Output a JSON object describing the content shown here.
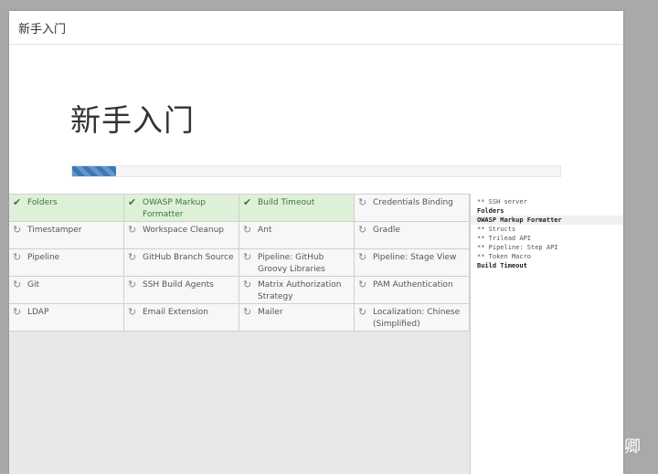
{
  "header": {
    "title": "新手入门"
  },
  "hero": {
    "title": "新手入门",
    "progress": 0.09
  },
  "plugins": [
    {
      "name": "Folders",
      "status": "success"
    },
    {
      "name": "OWASP Markup Formatter",
      "status": "success"
    },
    {
      "name": "Build Timeout",
      "status": "success"
    },
    {
      "name": "Credentials Binding",
      "status": "pending"
    },
    {
      "name": "Timestamper",
      "status": "pending"
    },
    {
      "name": "Workspace Cleanup",
      "status": "pending"
    },
    {
      "name": "Ant",
      "status": "pending"
    },
    {
      "name": "Gradle",
      "status": "pending"
    },
    {
      "name": "Pipeline",
      "status": "pending"
    },
    {
      "name": "GitHub Branch Source",
      "status": "pending"
    },
    {
      "name": "Pipeline: GitHub Groovy Libraries",
      "status": "pending"
    },
    {
      "name": "Pipeline: Stage View",
      "status": "pending"
    },
    {
      "name": "Git",
      "status": "pending"
    },
    {
      "name": "SSH Build Agents",
      "status": "pending"
    },
    {
      "name": "Matrix Authorization Strategy",
      "status": "pending"
    },
    {
      "name": "PAM Authentication",
      "status": "pending"
    },
    {
      "name": "LDAP",
      "status": "pending"
    },
    {
      "name": "Email Extension",
      "status": "pending"
    },
    {
      "name": "Mailer",
      "status": "pending"
    },
    {
      "name": "Localization: Chinese (Simplified)",
      "status": "pending"
    }
  ],
  "status_icons": {
    "success": "checkmark-icon",
    "pending": "refresh-icon"
  },
  "colors": {
    "success_bg": "#dff0d8",
    "progress": "#3a79b8"
  },
  "log": [
    {
      "text": "** SSH server",
      "style": "dep"
    },
    {
      "text": "Folders",
      "style": "bold"
    },
    {
      "text": "OWASP Markup Formatter",
      "style": "bold-hl"
    },
    {
      "text": "** Structs",
      "style": "dep"
    },
    {
      "text": "** Trilead API",
      "style": "dep"
    },
    {
      "text": "** Pipeline: Step API",
      "style": "dep"
    },
    {
      "text": "** Token Macro",
      "style": "dep"
    },
    {
      "text": "Build Timeout",
      "style": "bold"
    }
  ],
  "watermark": "知乎 @卿卿"
}
